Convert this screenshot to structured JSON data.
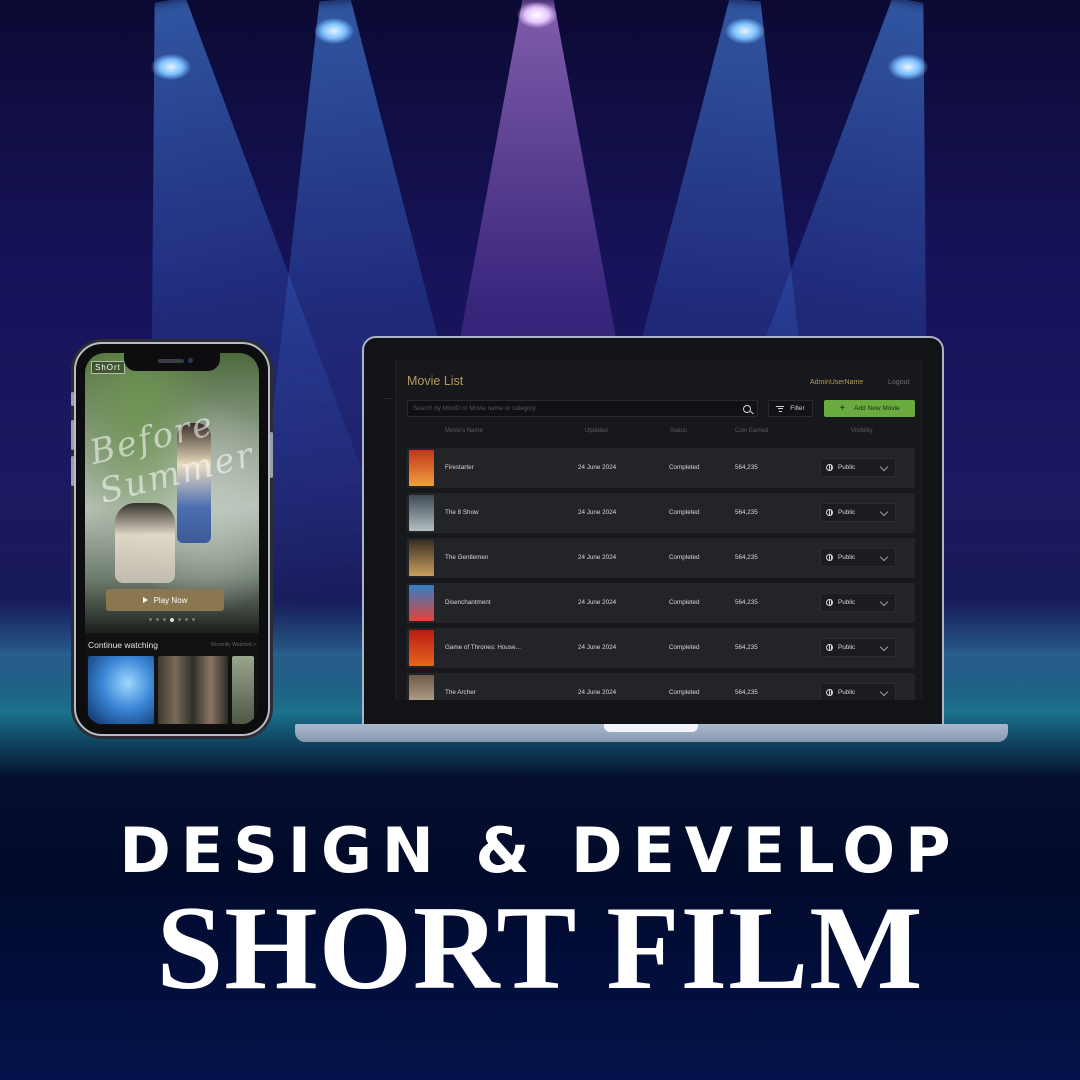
{
  "phone": {
    "logo": "ShOrt",
    "hero_script": "Before Summer",
    "play_label": "Play Now",
    "carousel_dot_count": 7,
    "carousel_active_dot": 3,
    "continue_title": "Continue watching",
    "continue_more": "Recently Watched >"
  },
  "admin": {
    "page_title": "Movie List",
    "username": "AdminUserName",
    "logout": "Logout",
    "search_placeholder": "Search by MovID or Movie name or category",
    "filter_label": "Filter",
    "add_label": "Add New Movie",
    "columns": {
      "name": "Movie's Name",
      "updated": "Updated",
      "status": "Status",
      "coin": "Coin Earned",
      "visibility": "Visibility"
    },
    "rows": [
      {
        "name": "Firestarter",
        "updated": "24 June 2024",
        "status": "Completed",
        "coin": "564,235",
        "visibility": "Public",
        "poster_colors": [
          "#c2341c",
          "#f0a23a"
        ]
      },
      {
        "name": "The 8 Show",
        "updated": "24 June 2024",
        "status": "Completed",
        "coin": "564,235",
        "visibility": "Public",
        "poster_colors": [
          "#3d4a52",
          "#b5bfc4"
        ]
      },
      {
        "name": "The Gentlemen",
        "updated": "24 June 2024",
        "status": "Completed",
        "coin": "564,235",
        "visibility": "Public",
        "poster_colors": [
          "#3a2f24",
          "#c99f5c"
        ]
      },
      {
        "name": "Disenchantment",
        "updated": "24 June 2024",
        "status": "Completed",
        "coin": "564,235",
        "visibility": "Public",
        "poster_colors": [
          "#2f7fc4",
          "#e0443c"
        ]
      },
      {
        "name": "Game of Thrones: House...",
        "updated": "24 June 2024",
        "status": "Completed",
        "coin": "564,235",
        "visibility": "Public",
        "poster_colors": [
          "#b81c12",
          "#e8651e"
        ]
      },
      {
        "name": "The Archer",
        "updated": "24 June 2024",
        "status": "Completed",
        "coin": "564,235",
        "visibility": "Public",
        "poster_colors": [
          "#6e5a48",
          "#c9b79e"
        ]
      }
    ]
  },
  "headline": "DESIGN & DEVELOP",
  "subheadline": "SHORT FILM",
  "colors": {
    "accent_gold": "#b69a5c",
    "add_button_green": "#6aab40",
    "play_button": "#8a7750"
  }
}
